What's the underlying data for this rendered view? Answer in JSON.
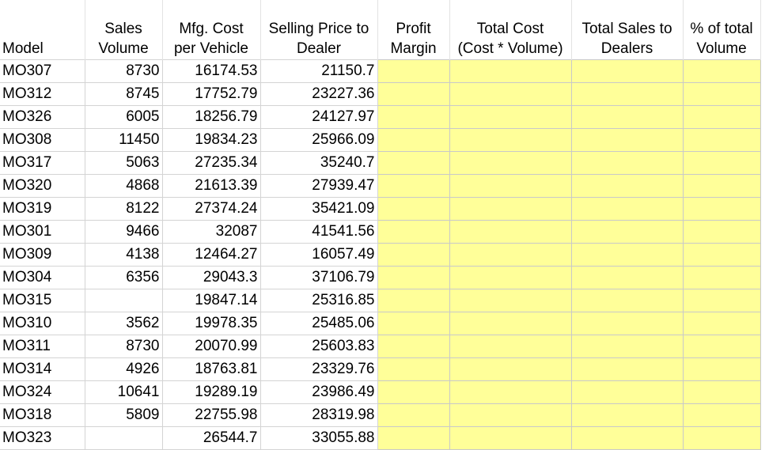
{
  "spreadsheet": {
    "headers": [
      {
        "line1": "",
        "line2": "Model"
      },
      {
        "line1": "Sales",
        "line2": "Volume"
      },
      {
        "line1": "Mfg. Cost",
        "line2": "per Vehicle"
      },
      {
        "line1": "Selling Price to",
        "line2": "Dealer"
      },
      {
        "line1": "Profit",
        "line2": "Margin"
      },
      {
        "line1": "Total Cost",
        "line2": "(Cost * Volume)"
      },
      {
        "line1": "Total Sales to",
        "line2": "Dealers"
      },
      {
        "line1": "% of total",
        "line2": "Volume"
      }
    ],
    "rows": [
      {
        "model": "MO307",
        "volume": "8730",
        "cost": "16174.53",
        "price": "21150.7"
      },
      {
        "model": "MO312",
        "volume": "8745",
        "cost": "17752.79",
        "price": "23227.36"
      },
      {
        "model": "MO326",
        "volume": "6005",
        "cost": "18256.79",
        "price": "24127.97"
      },
      {
        "model": "MO308",
        "volume": "11450",
        "cost": "19834.23",
        "price": "25966.09"
      },
      {
        "model": "MO317",
        "volume": "5063",
        "cost": "27235.34",
        "price": "35240.7"
      },
      {
        "model": "MO320",
        "volume": "4868",
        "cost": "21613.39",
        "price": "27939.47"
      },
      {
        "model": "MO319",
        "volume": "8122",
        "cost": "27374.24",
        "price": "35421.09"
      },
      {
        "model": "MO301",
        "volume": "9466",
        "cost": "32087",
        "price": "41541.56"
      },
      {
        "model": "MO309",
        "volume": "4138",
        "cost": "12464.27",
        "price": "16057.49"
      },
      {
        "model": "MO304",
        "volume": "6356",
        "cost": "29043.3",
        "price": "37106.79"
      },
      {
        "model": "MO315",
        "volume": "",
        "cost": "19847.14",
        "price": "25316.85"
      },
      {
        "model": "MO310",
        "volume": "3562",
        "cost": "19978.35",
        "price": "25485.06"
      },
      {
        "model": "MO311",
        "volume": "8730",
        "cost": "20070.99",
        "price": "25603.83"
      },
      {
        "model": "MO314",
        "volume": "4926",
        "cost": "18763.81",
        "price": "23329.76"
      },
      {
        "model": "MO324",
        "volume": "10641",
        "cost": "19289.19",
        "price": "23986.49"
      },
      {
        "model": "MO318",
        "volume": "5809",
        "cost": "22755.98",
        "price": "28319.98"
      },
      {
        "model": "MO323",
        "volume": "",
        "cost": "26544.7",
        "price": "33055.88"
      }
    ],
    "highlight_color": "#ffff99"
  }
}
